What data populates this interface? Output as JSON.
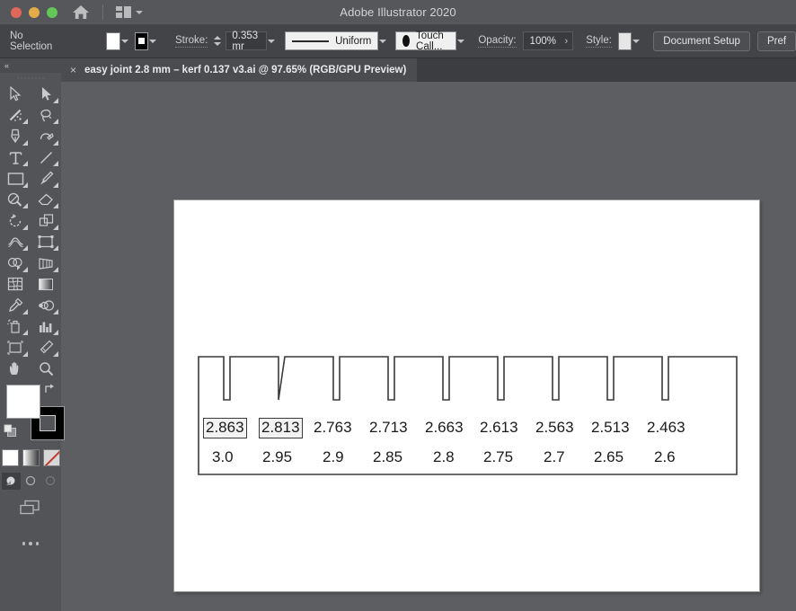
{
  "window": {
    "app_title": "Adobe Illustrator 2020",
    "traffic_lights": [
      "close",
      "minimize",
      "maximize"
    ],
    "home_icon": "home-icon",
    "arrange_documents_icon": "arrange-documents-icon"
  },
  "control_bar": {
    "selection_status": "No Selection",
    "fill_label": "fill-swatch",
    "stroke_swatch_label": "stroke-swatch",
    "stroke_label": "Stroke:",
    "stroke_weight": "0.353 mr",
    "stroke_profile": "Uniform",
    "brush_definition": "Touch Call...",
    "opacity_label": "Opacity:",
    "opacity_value": "100%",
    "style_label": "Style:",
    "document_setup": "Document Setup",
    "preferences": "Pref"
  },
  "tab": {
    "close_glyph": "×",
    "title": "easy joint 2.8 mm – kerf 0.137 v3.ai @ 97.65% (RGB/GPU Preview)"
  },
  "toolbar": {
    "collapse_glyph": "«",
    "tools": [
      "selection-tool",
      "direct-selection-tool",
      "magic-wand-tool",
      "lasso-tool",
      "pen-tool",
      "curvature-tool",
      "type-tool",
      "line-segment-tool",
      "rectangle-tool",
      "paintbrush-tool",
      "shaper-tool",
      "eraser-tool",
      "rotate-tool",
      "scale-tool",
      "width-tool",
      "free-transform-tool",
      "shape-builder-tool",
      "perspective-grid-tool",
      "mesh-tool",
      "gradient-tool",
      "eyedropper-tool",
      "blend-tool",
      "symbol-sprayer-tool",
      "column-graph-tool",
      "artboard-tool",
      "slice-tool",
      "hand-tool",
      "zoom-tool"
    ],
    "fill_color": "#ffffff",
    "stroke_color": "#000000",
    "paint_modes": [
      "color-mode",
      "gradient-mode",
      "none-mode"
    ],
    "drawing_modes": [
      "draw-normal",
      "draw-behind",
      "draw-inside"
    ],
    "screen_mode": "change-screen-mode",
    "more_tools_glyph": "•••"
  },
  "artwork": {
    "description": "kerf test comb with ten teeth and nine slots",
    "slot_count": 9,
    "tooth_count": 10,
    "kerf_labels": [
      "2.863",
      "2.813",
      "2.763",
      "2.713",
      "2.663",
      "2.613",
      "2.563",
      "2.513",
      "2.463"
    ],
    "size_labels": [
      "3.0",
      "2.95",
      "2.9",
      "2.85",
      "2.8",
      "2.75",
      "2.7",
      "2.65",
      "2.6"
    ],
    "selected_label_indices": [
      0,
      1
    ],
    "stroke_color": "#333333"
  }
}
